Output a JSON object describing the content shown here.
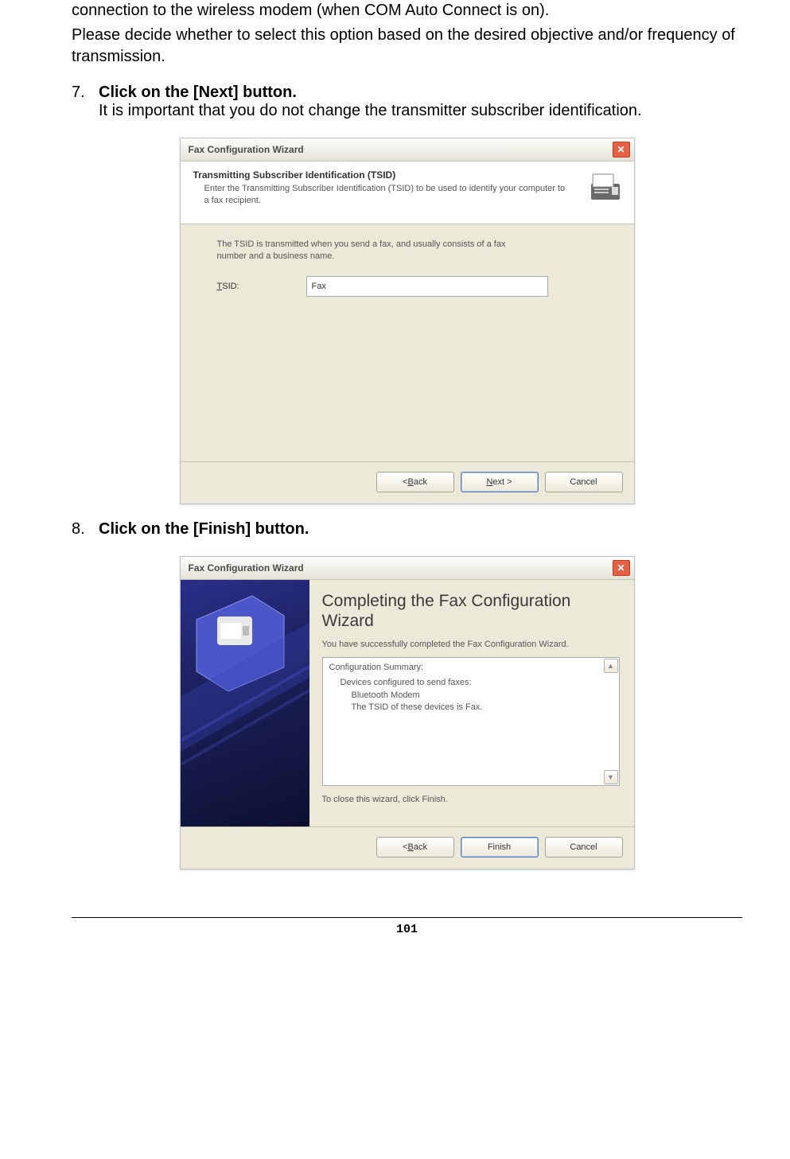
{
  "intro": {
    "line1": "connection to the wireless modem (when COM Auto Connect is on).",
    "line2": "Please decide whether to select this option based on the desired objective and/or frequency of transmission."
  },
  "step7": {
    "num": "7.",
    "title": "Click on the [Next] button.",
    "text": "It is important that you do not change the transmitter subscriber identification."
  },
  "wizard1": {
    "title": "Fax Configuration Wizard",
    "header_title": "Transmitting Subscriber Identification (TSID)",
    "header_sub": "Enter the Transmitting Subscriber Identification (TSID) to be used to identify your computer to a fax recipient.",
    "body_desc": "The TSID is transmitted when you send a fax, and usually consists of a fax number and a business name.",
    "tsid_label_pre": "T",
    "tsid_label_post": "SID:",
    "tsid_value": "Fax",
    "back": "< ",
    "back_u": "B",
    "back_post": "ack",
    "next_u": "N",
    "next_post": "ext >",
    "cancel": "Cancel"
  },
  "step8": {
    "num": "8.",
    "title": "Click on the [Finish] button."
  },
  "wizard2": {
    "title": "Fax Configuration Wizard",
    "complete_title": "Completing the Fax Configuration Wizard",
    "complete_text": "You have successfully completed the Fax Configuration Wizard.",
    "summary_header": "Configuration Summary:",
    "summary_line1": "Devices configured to send faxes:",
    "summary_line2": "Bluetooth Modem",
    "summary_line3": "The TSID of these devices is Fax.",
    "close_text": "To close this wizard, click Finish.",
    "back": "< ",
    "back_u": "B",
    "back_post": "ack",
    "finish": "Finish",
    "cancel": "Cancel"
  },
  "page_number": "101"
}
